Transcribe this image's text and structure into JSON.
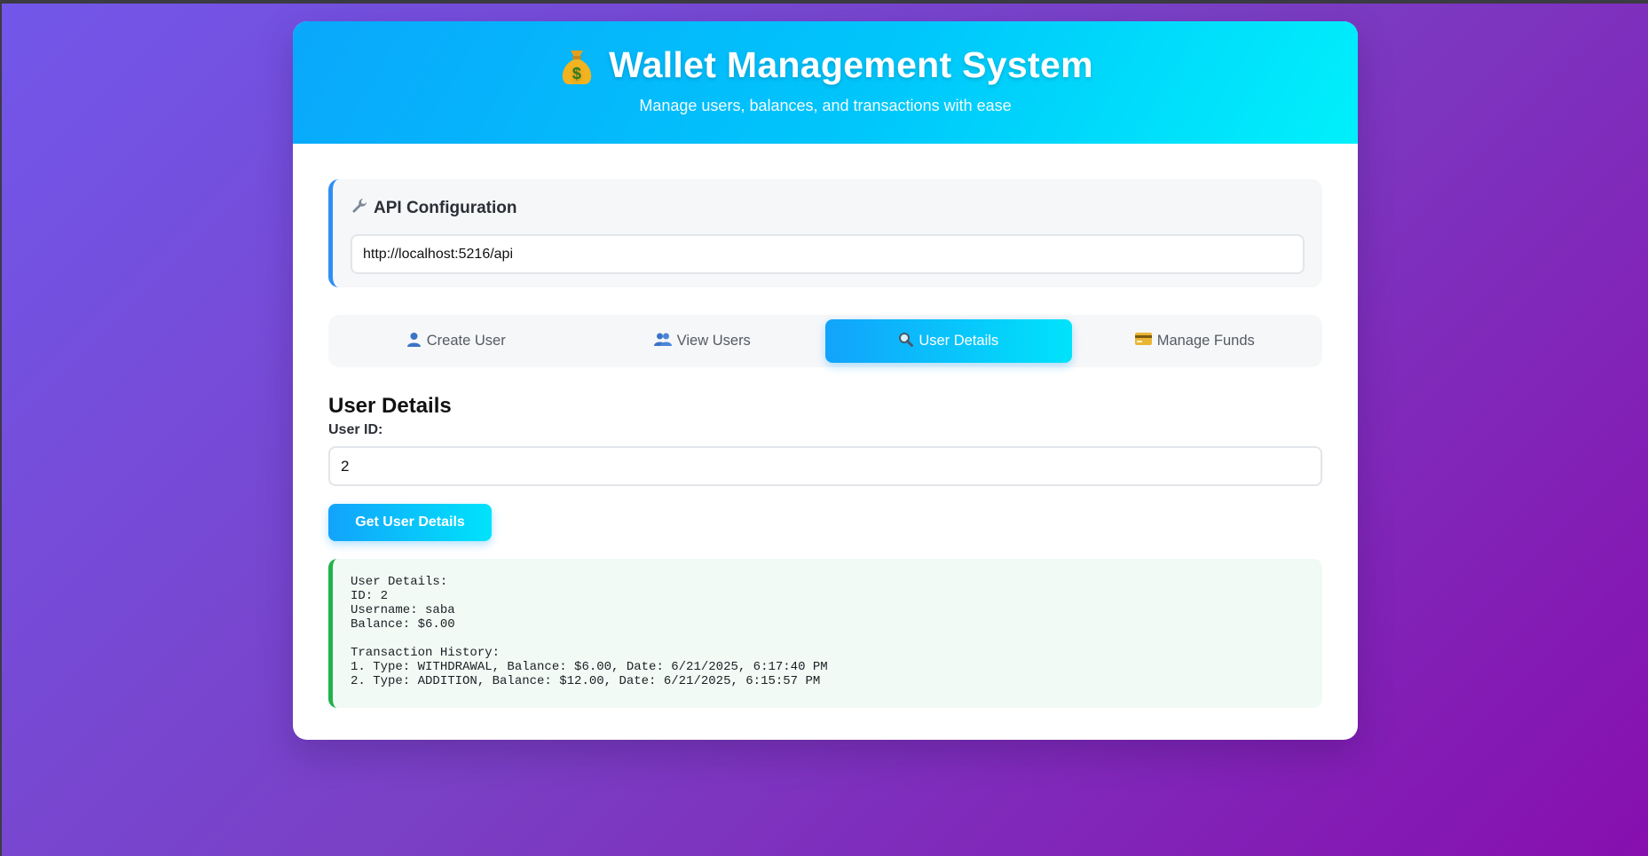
{
  "header": {
    "title": "Wallet Management System",
    "subtitle": "Manage users, balances, and transactions with ease",
    "icon": "money-bag-icon"
  },
  "config": {
    "title": "API Configuration",
    "icon": "wrench-icon",
    "api_url": "http://localhost:5216/api"
  },
  "tabs": [
    {
      "label": "Create User",
      "icon": "user-icon",
      "active": false
    },
    {
      "label": "View Users",
      "icon": "users-icon",
      "active": false
    },
    {
      "label": "User Details",
      "icon": "magnifier-icon",
      "active": true
    },
    {
      "label": "Manage Funds",
      "icon": "credit-card-icon",
      "active": false
    }
  ],
  "section": {
    "title": "User Details",
    "user_id_label": "User ID:",
    "user_id_value": "2",
    "button_label": "Get User Details"
  },
  "result": {
    "lines": [
      "User Details:",
      "ID: 2",
      "Username: saba",
      "Balance: $6.00"
    ],
    "history_title": "Transaction History:",
    "history": [
      "1. Type: WITHDRAWAL, Balance: $6.00, Date: 6/21/2025, 6:17:40 PM",
      "2. Type: ADDITION, Balance: $12.00, Date: 6/21/2025, 6:15:57 PM"
    ]
  },
  "colors": {
    "accent": "#00c6fb",
    "active_tab_start": "#12a3fb",
    "active_tab_end": "#00e3fb",
    "success_border": "#22b24c",
    "config_border": "#2f8ef5"
  }
}
